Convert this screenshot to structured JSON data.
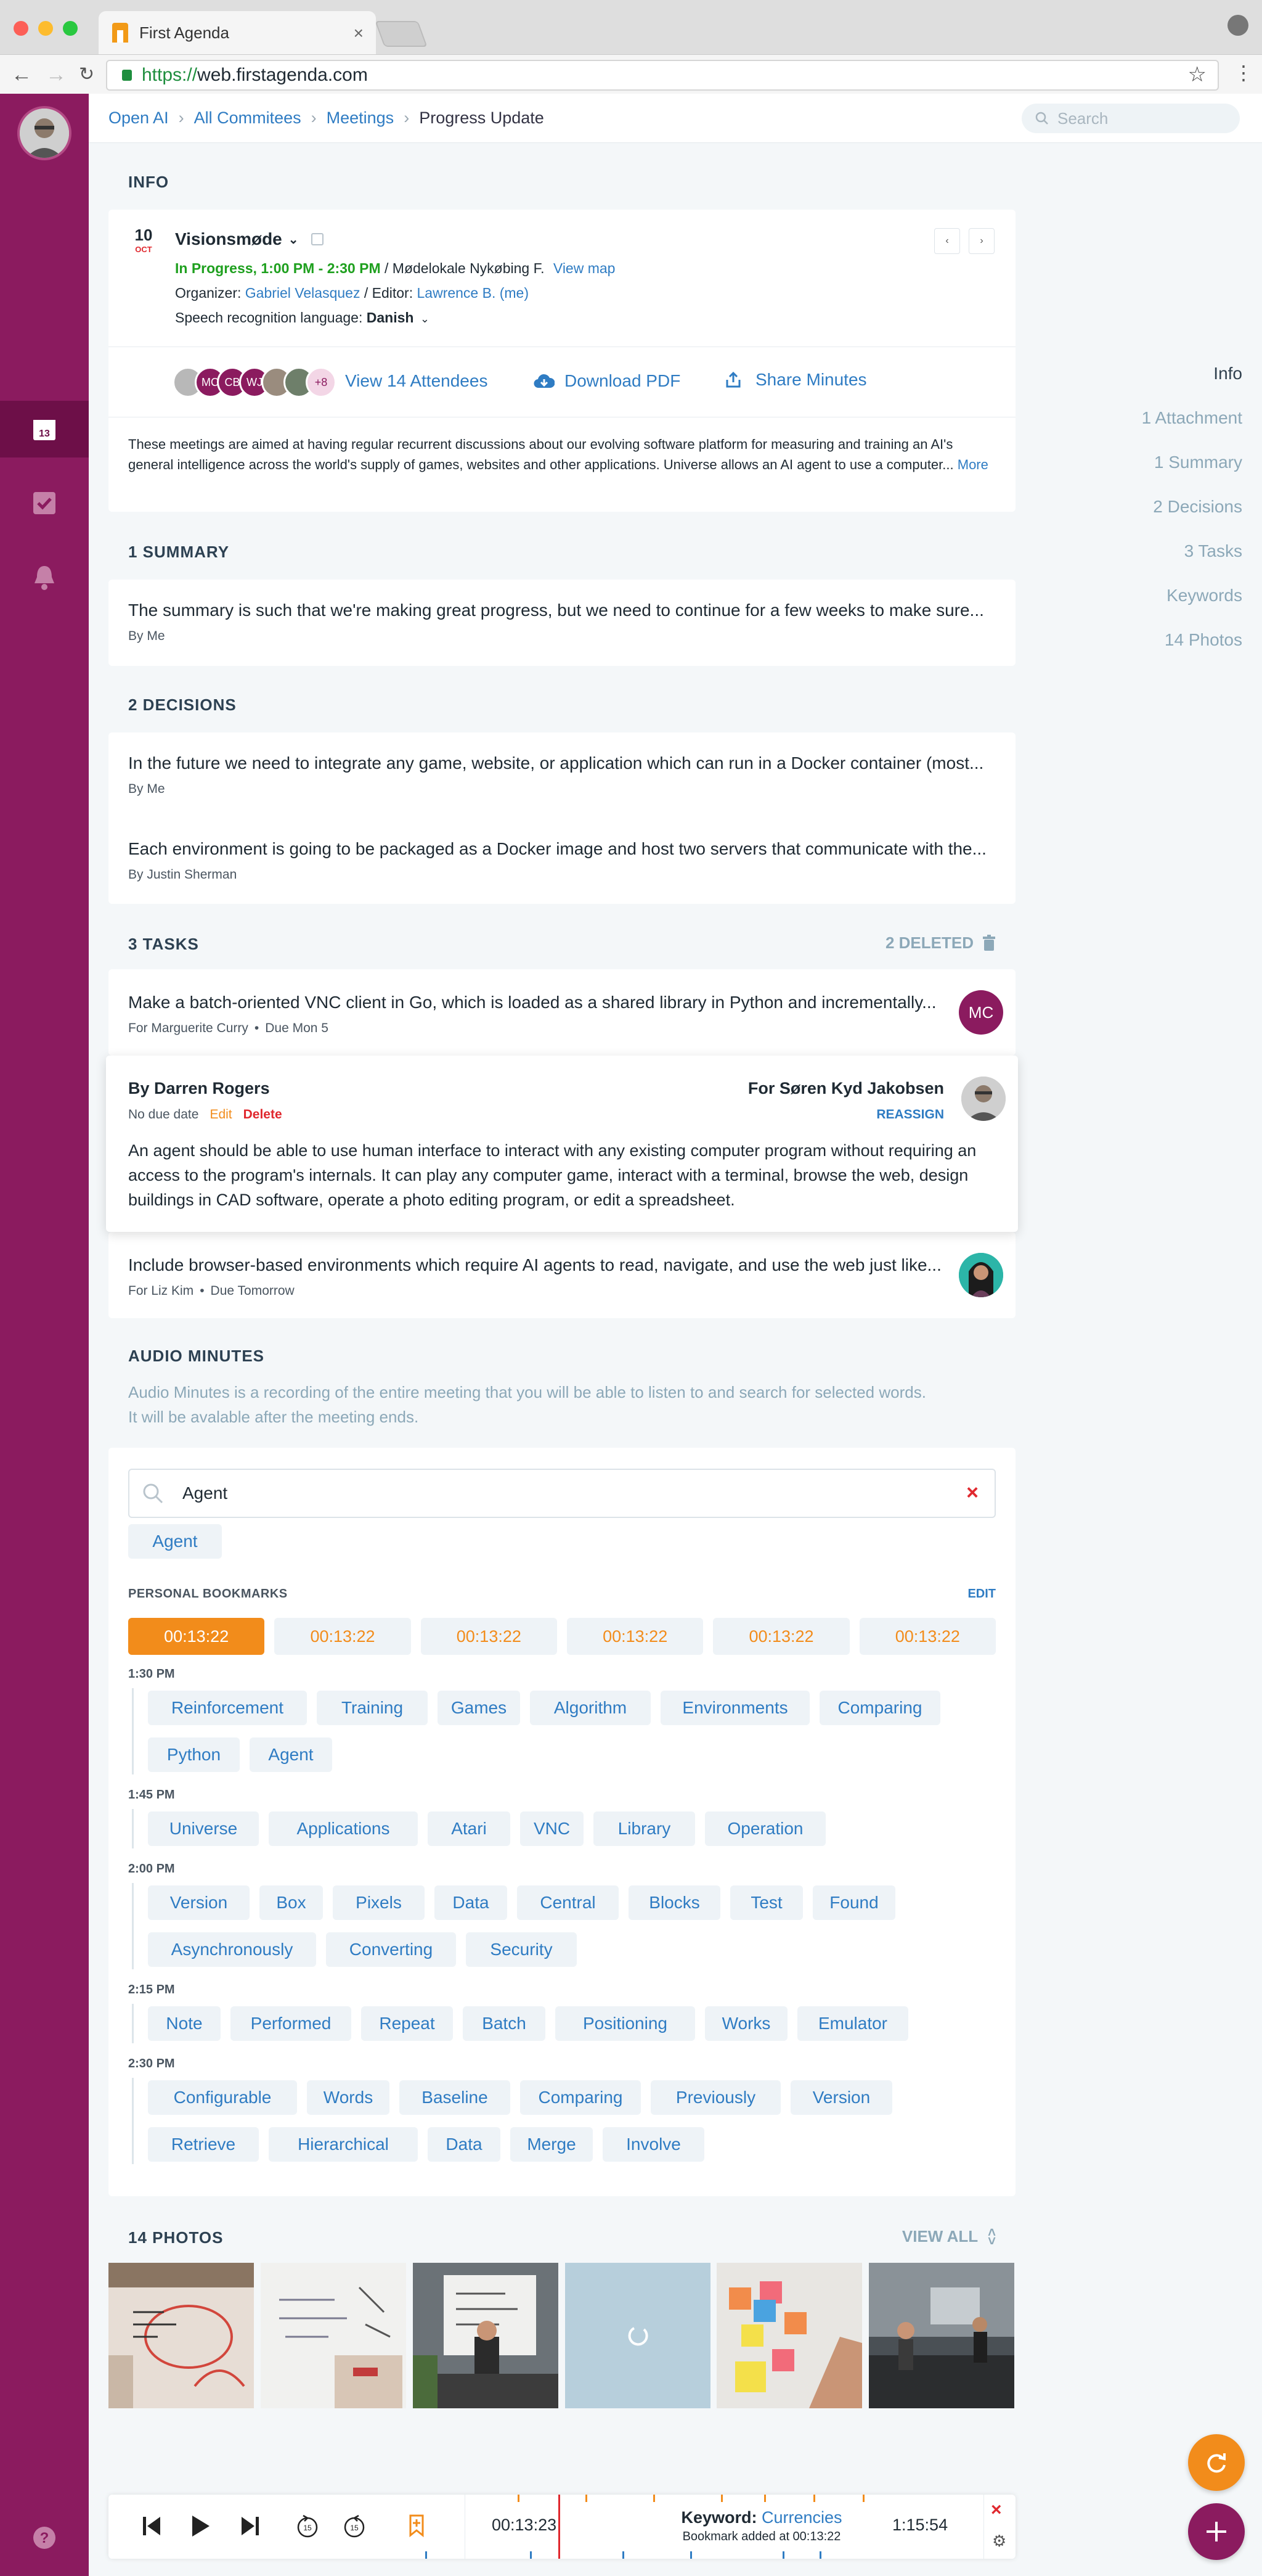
{
  "browser": {
    "tab_title": "First Agenda",
    "url_scheme": "https://",
    "url_host": "web.firstagenda.com"
  },
  "breadcrumb": [
    "Open AI",
    "All Commitees",
    "Meetings",
    "Progress Update"
  ],
  "search": {
    "placeholder": "Search"
  },
  "right_nav": [
    "Info",
    "1 Attachment",
    "1 Summary",
    "2 Decisions",
    "3 Tasks",
    "Keywords",
    "14 Photos"
  ],
  "info": {
    "section_title": "INFO",
    "date_day": "10",
    "date_month": "OCT",
    "meeting_name": "Visionsmøde",
    "status": "In Progress, 1:00 PM - 2:30 PM",
    "location": " / Mødelokale Nykøbing F.",
    "view_map": "View map",
    "organizer_label": "Organizer: ",
    "organizer": "Gabriel Velasquez",
    "editor_label": " / Editor: ",
    "editor": "Lawrence B. (me)",
    "speech_label": "Speech recognition language: ",
    "speech_lang": "Danish",
    "attendee_initials": [
      "MC",
      "CB",
      "WJ"
    ],
    "attendee_more": "+8",
    "view_attendees": "View 14 Attendees",
    "download_pdf": "Download PDF",
    "share_minutes": "Share Minutes",
    "description": "These meetings are aimed at having regular recurrent discussions about our evolving software platform for measuring and training an AI's general intelligence across the world's supply of games, websites and other applications. Universe allows an AI agent to use a computer...",
    "more": "More"
  },
  "summary": {
    "section_title": "1 SUMMARY",
    "text": "The summary is such that we're making great progress, but we need to continue for a few weeks to make sure...",
    "by": "By Me"
  },
  "decisions": {
    "section_title": "2 DECISIONS",
    "items": [
      {
        "text": "In the future we need to integrate any game, website, or application which can run in a Docker container (most...",
        "by": "By Me"
      },
      {
        "text": "Each environment is going to be packaged as a Docker image and host two servers that communicate with the...",
        "by": "By Justin Sherman"
      }
    ]
  },
  "tasks": {
    "section_title": "3 TASKS",
    "deleted": "2 DELETED",
    "task1": {
      "text": "Make a batch-oriented VNC client in Go, which is loaded as a shared library in Python and incrementally...",
      "for": "For Marguerite Curry",
      "due": "Due Mon 5",
      "initials": "MC"
    },
    "task2": {
      "by": "By Darren Rogers",
      "due": "No due date",
      "edit": "Edit",
      "delete": "Delete",
      "for": "For Søren Kyd Jakobsen",
      "reassign": "REASSIGN",
      "text": "An agent should be able to use human interface to interact with any existing computer program without requiring an access to the program's internals. It can play any computer game, interact with a terminal, browse the web, design buildings in CAD software, operate a photo editing program, or edit a spreadsheet."
    },
    "task3": {
      "text": "Include browser-based environments which require AI agents to read, navigate, and use the web just like...",
      "for": "For Liz Kim",
      "due": "Due Tomorrow"
    }
  },
  "audio": {
    "section_title": "AUDIO MINUTES",
    "description_1": "Audio Minutes is a recording of the entire meeting that you will be able to listen to and search for selected words.",
    "description_2": "It will be avalable after the meeting ends.",
    "search_value": "Agent",
    "selected_keyword": "Agent",
    "bookmarks_label": "PERSONAL BOOKMARKS",
    "edit": "EDIT",
    "bookmarks": [
      "00:13:22",
      "00:13:22",
      "00:13:22",
      "00:13:22",
      "00:13:22",
      "00:13:22"
    ],
    "groups": [
      {
        "time": "1:30 PM",
        "rows": [
          [
            "Reinforcement",
            "Training",
            "Games",
            "Algorithm",
            "Environments",
            "Comparing"
          ],
          [
            "Python",
            "Agent"
          ]
        ]
      },
      {
        "time": "1:45 PM",
        "rows": [
          [
            "Universe",
            "Applications",
            "Atari",
            "VNC",
            "Library",
            "Operation"
          ]
        ]
      },
      {
        "time": "2:00 PM",
        "rows": [
          [
            "Version",
            "Box",
            "Pixels",
            "Data",
            "Central",
            "Blocks",
            "Test",
            "Found"
          ],
          [
            "Asynchronously",
            "Converting",
            "Security"
          ]
        ]
      },
      {
        "time": "2:15 PM",
        "rows": [
          [
            "Note",
            "Performed",
            "Repeat",
            "Batch",
            "Positioning",
            "Works",
            "Emulator"
          ]
        ]
      },
      {
        "time": "2:30 PM",
        "rows": [
          [
            "Configurable",
            "Words",
            "Baseline",
            "Comparing",
            "Previously",
            "Version"
          ],
          [
            "Retrieve",
            "Hierarchical",
            "Data",
            "Merge",
            "Involve"
          ]
        ]
      }
    ]
  },
  "photos": {
    "section_title": "14 PHOTOS",
    "view_all": "VIEW ALL"
  },
  "player": {
    "current_time": "00:13:23",
    "keyword_label": "Keyword: ",
    "keyword": "Currencies",
    "bookmark_note": "Bookmark added at 00:13:22",
    "total_time": "1:15:54"
  },
  "colors": {
    "sidebar": "#8b1b5f",
    "accent_blue": "#2f7cc3",
    "orange": "#f28c1b",
    "green": "#1fa01f",
    "red": "#e0282e"
  }
}
